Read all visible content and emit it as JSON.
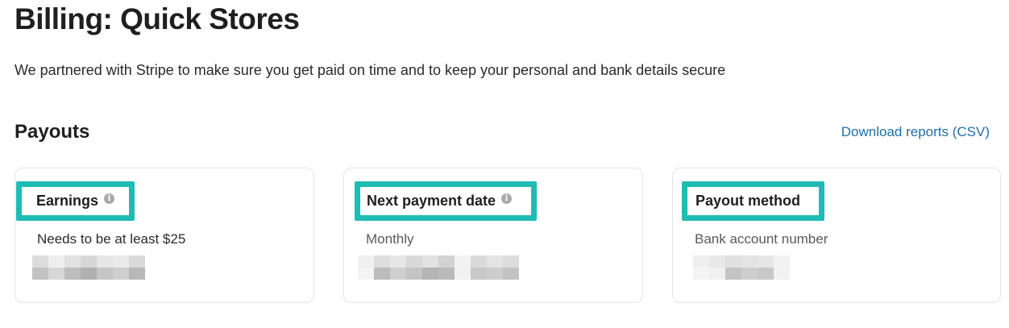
{
  "page": {
    "title": "Billing: Quick Stores",
    "subtitle": "We partnered with Stripe to make sure you get paid on time and to keep your personal and bank details secure"
  },
  "payouts": {
    "section_title": "Payouts",
    "download_link": "Download reports (CSV)",
    "cards": [
      {
        "label": "Earnings",
        "has_info_icon": true,
        "description": "Needs to be at least $25",
        "redacted_value": true
      },
      {
        "label": "Next payment date",
        "has_info_icon": true,
        "description": "Monthly",
        "redacted_value": true
      },
      {
        "label": "Payout method",
        "has_info_icon": false,
        "description": "Bank account number",
        "redacted_value": true
      }
    ]
  },
  "icons": {
    "info": "info-icon",
    "info_glyph": "i"
  },
  "colors": {
    "highlight_border": "#1fbcb4",
    "link": "#1f6fa8",
    "info_icon": "#a9a9a9",
    "card_border": "#e3e3e3"
  }
}
